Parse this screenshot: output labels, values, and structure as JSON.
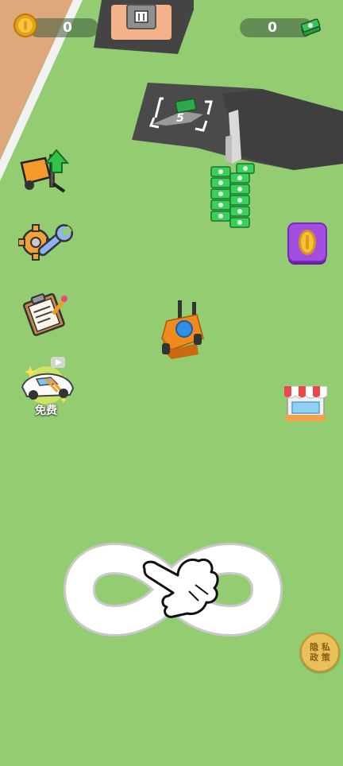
{
  "hud": {
    "coins_value": "0",
    "cash_value": "0"
  },
  "unlock_pad": {
    "cost": "5"
  },
  "side_buttons": {
    "free_car_label": "免费"
  },
  "privacy": {
    "line1": "隐 私",
    "line2": "政 策"
  },
  "icons": {
    "coin": "coin-icon",
    "cash": "cash-icon",
    "forklift_upgrade": "forklift-upgrade-icon",
    "settings": "gear-wrench-icon",
    "tasks": "clipboard-icon",
    "free_car": "car-icon",
    "shop": "shop-icon",
    "coin_shop": "coin-button-icon",
    "trash": "trash-icon",
    "tutorial_hand": "hand-pointer-icon"
  },
  "colors": {
    "ground": "#93cc71",
    "asphalt": "#4a4a4a",
    "sand": "#dea87c",
    "accent_orange": "#f08a1e",
    "purple_button": "#9b45d6"
  }
}
